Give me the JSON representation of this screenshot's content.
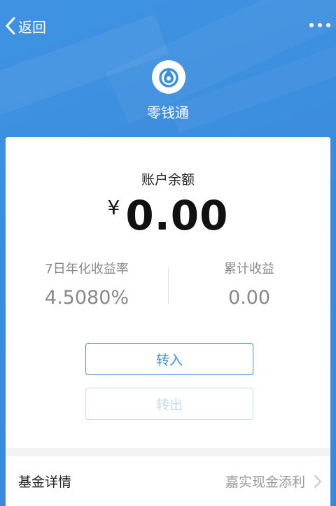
{
  "topbar": {
    "back_label": "返回"
  },
  "app": {
    "name": "零钱通"
  },
  "account": {
    "balance_label": "账户余额",
    "currency": "¥",
    "amount": "0.00"
  },
  "stats": {
    "yield_label": "7日年化收益率",
    "yield_value": "4.5080%",
    "cumulative_label": "累计收益",
    "cumulative_value": "0.00"
  },
  "actions": {
    "transfer_in": "转入",
    "transfer_out": "转出"
  },
  "fund": {
    "label": "基金详情",
    "name": "嘉实现金添利"
  },
  "colors": {
    "brand_blue": "#3d8fdf",
    "disabled_text": "#c4dbf0"
  }
}
